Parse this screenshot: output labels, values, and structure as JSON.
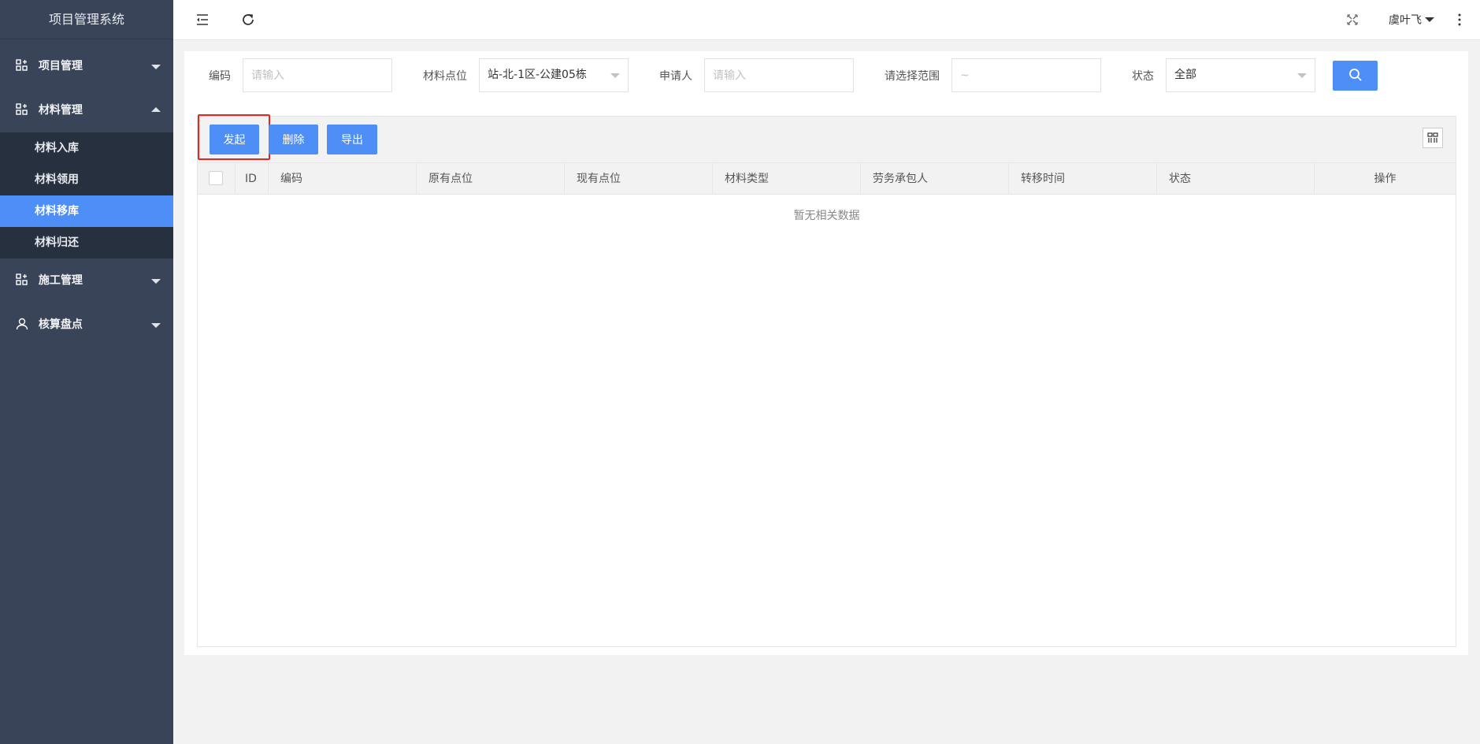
{
  "app": {
    "title": "项目管理系统"
  },
  "sidebar": {
    "items": [
      {
        "label": "项目管理",
        "expanded": false
      },
      {
        "label": "材料管理",
        "expanded": true,
        "children": [
          "材料入库",
          "材料领用",
          "材料移库",
          "材料归还"
        ],
        "active_child": "材料移库"
      },
      {
        "label": "施工管理",
        "expanded": false
      },
      {
        "label": "核算盘点",
        "expanded": false
      }
    ]
  },
  "header": {
    "user": "虞叶飞"
  },
  "filters": {
    "code": {
      "label": "编码",
      "placeholder": "请输入"
    },
    "location": {
      "label": "材料点位",
      "value": "站-北-1区-公建05栋"
    },
    "applicant": {
      "label": "申请人",
      "placeholder": "请输入"
    },
    "range": {
      "label": "请选择范围",
      "placeholder": "~"
    },
    "status": {
      "label": "状态",
      "value": "全部"
    }
  },
  "toolbar": {
    "initiate": "发起",
    "delete": "删除",
    "export": "导出"
  },
  "table": {
    "columns": [
      "ID",
      "编码",
      "原有点位",
      "现有点位",
      "材料类型",
      "劳务承包人",
      "转移时间",
      "状态",
      "操作"
    ],
    "empty_text": "暂无相关数据"
  },
  "colors": {
    "primary": "#4e8ef7",
    "sidebar": "#3a4459",
    "submenu": "#27303f",
    "highlight": "#e8261f"
  }
}
